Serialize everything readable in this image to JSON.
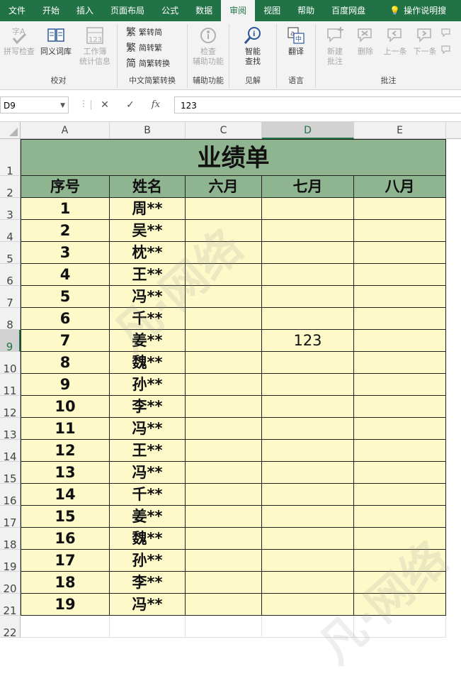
{
  "ribbon": {
    "tabs": [
      {
        "label": "文件",
        "active": false
      },
      {
        "label": "开始",
        "active": false
      },
      {
        "label": "插入",
        "active": false
      },
      {
        "label": "页面布局",
        "active": false
      },
      {
        "label": "公式",
        "active": false
      },
      {
        "label": "数据",
        "active": false
      },
      {
        "label": "审阅",
        "active": true
      },
      {
        "label": "视图",
        "active": false
      },
      {
        "label": "帮助",
        "active": false
      },
      {
        "label": "百度网盘",
        "active": false
      }
    ],
    "tell_me": "操作说明搜",
    "groups": {
      "proofing": {
        "label": "校对",
        "spell": "拼写检查",
        "thesaurus": "同义词库",
        "workbook_stats_line1": "工作簿",
        "workbook_stats_line2": "统计信息"
      },
      "chinese": {
        "label": "中文简繁转换",
        "to_simplified_label": "繁转简",
        "to_traditional_label": "简转繁",
        "convert_label": "简繁转换"
      },
      "accessibility": {
        "label": "辅助功能",
        "check_line1": "检查",
        "check_line2": "辅助功能"
      },
      "insights": {
        "label": "见解",
        "smart_line1": "智能",
        "smart_line2": "查找"
      },
      "language": {
        "label": "语言",
        "translate": "翻译"
      },
      "comments": {
        "label": "批注",
        "new_line1": "新建",
        "new_line2": "批注",
        "delete": "删除",
        "prev": "上一条",
        "next": "下一条"
      }
    }
  },
  "formula_bar": {
    "name_box": "D9",
    "cancel_symbol": "✕",
    "enter_symbol": "✓",
    "fx_symbol": "fx",
    "value": "123"
  },
  "sheet": {
    "columns": [
      "A",
      "B",
      "C",
      "D",
      "E"
    ],
    "selected_column": "D",
    "selected_row": 9,
    "title": "业绩单",
    "headers": [
      "序号",
      "姓名",
      "六月",
      "七月",
      "八月"
    ],
    "rows": [
      {
        "no": "1",
        "name": "周**",
        "jun": "",
        "jul": "",
        "aug": ""
      },
      {
        "no": "2",
        "name": "吴**",
        "jun": "",
        "jul": "",
        "aug": ""
      },
      {
        "no": "3",
        "name": "枕**",
        "jun": "",
        "jul": "",
        "aug": ""
      },
      {
        "no": "4",
        "name": "王**",
        "jun": "",
        "jul": "",
        "aug": ""
      },
      {
        "no": "5",
        "name": "冯**",
        "jun": "",
        "jul": "",
        "aug": ""
      },
      {
        "no": "6",
        "name": "千**",
        "jun": "",
        "jul": "",
        "aug": ""
      },
      {
        "no": "7",
        "name": "姜**",
        "jun": "",
        "jul": "123",
        "aug": ""
      },
      {
        "no": "8",
        "name": "魏**",
        "jun": "",
        "jul": "",
        "aug": ""
      },
      {
        "no": "9",
        "name": "孙**",
        "jun": "",
        "jul": "",
        "aug": ""
      },
      {
        "no": "10",
        "name": "李**",
        "jun": "",
        "jul": "",
        "aug": ""
      },
      {
        "no": "11",
        "name": "冯**",
        "jun": "",
        "jul": "",
        "aug": ""
      },
      {
        "no": "12",
        "name": "王**",
        "jun": "",
        "jul": "",
        "aug": ""
      },
      {
        "no": "13",
        "name": "冯**",
        "jun": "",
        "jul": "",
        "aug": ""
      },
      {
        "no": "14",
        "name": "千**",
        "jun": "",
        "jul": "",
        "aug": ""
      },
      {
        "no": "15",
        "name": "姜**",
        "jun": "",
        "jul": "",
        "aug": ""
      },
      {
        "no": "16",
        "name": "魏**",
        "jun": "",
        "jul": "",
        "aug": ""
      },
      {
        "no": "17",
        "name": "孙**",
        "jun": "",
        "jul": "",
        "aug": ""
      },
      {
        "no": "18",
        "name": "李**",
        "jun": "",
        "jul": "",
        "aug": ""
      },
      {
        "no": "19",
        "name": "冯**",
        "jun": "",
        "jul": "",
        "aug": ""
      }
    ],
    "row_numbers": [
      "1",
      "2",
      "3",
      "4",
      "5",
      "6",
      "7",
      "8",
      "9",
      "10",
      "11",
      "12",
      "13",
      "14",
      "15",
      "16",
      "17",
      "18",
      "19",
      "20",
      "21",
      "22"
    ],
    "watermark": "凡·网络"
  },
  "colors": {
    "ribbon_green": "#217346",
    "header_fill": "#8fb590",
    "data_fill": "#fdf9c9"
  }
}
